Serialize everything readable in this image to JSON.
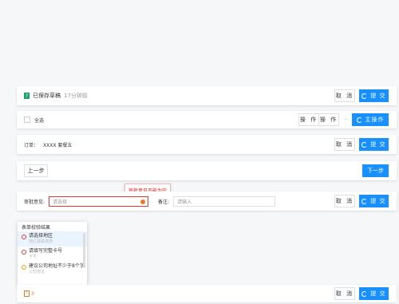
{
  "row1": {
    "status": "已保存草稿",
    "time": "17分钟前",
    "cancel": "取 消",
    "submit": "提 交"
  },
  "row2": {
    "select_all": "全选",
    "op1": "操 作",
    "op2": "操 作",
    "more": "···",
    "main_op": "主操作"
  },
  "row3": {
    "order_label": "订单：",
    "order_value": "XXXX 套餐五",
    "cancel": "取 消",
    "submit": "提 交"
  },
  "row4": {
    "prev": "上一步",
    "next": "下一步"
  },
  "row5": {
    "approve_label": "审批意见:",
    "approve_placeholder": "请选择",
    "remark_label": "备注:",
    "remark_placeholder": "请输入",
    "cancel": "取 消",
    "submit": "提 交",
    "tooltip": "审批意见不能为空"
  },
  "validation": {
    "title": "表单校验结果",
    "items": [
      {
        "title": "请选择地区",
        "sub": "地区极联选择",
        "level": "error"
      },
      {
        "title": "请填写完整卡号",
        "sub": "卡号",
        "level": "error"
      },
      {
        "title": "建议公司地址不少于8个字",
        "sub": "公司地址",
        "level": "warning"
      }
    ]
  },
  "row6": {
    "error_count": "3",
    "cancel": "取 消",
    "submit": "提 交"
  },
  "colors": {
    "primary": "#1890ff",
    "error": "#e53935",
    "warning": "#f39c12",
    "success": "#22a06b"
  }
}
